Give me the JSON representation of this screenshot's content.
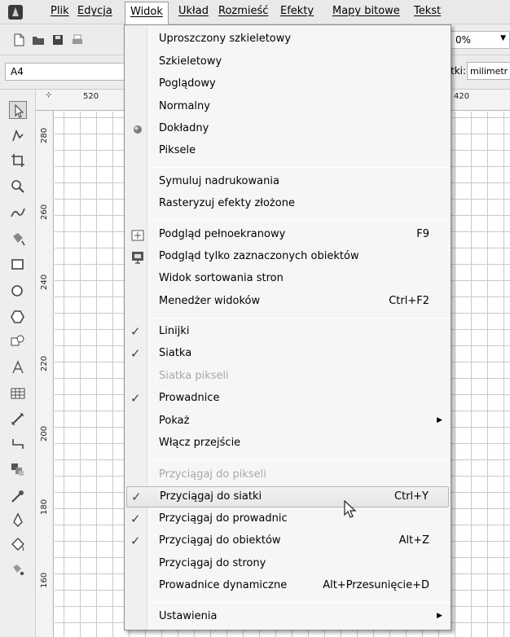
{
  "menubar": {
    "items": [
      {
        "label": "Plik"
      },
      {
        "label": "Edycja"
      },
      {
        "label": "Widok"
      },
      {
        "label": "Układ"
      },
      {
        "label": "Rozmieść"
      },
      {
        "label": "Efekty"
      },
      {
        "label": "Mapy bitowe"
      },
      {
        "label": "Tekst"
      }
    ]
  },
  "toolbar": {
    "zoom_value": "0%"
  },
  "propbar": {
    "page_size": "A4",
    "units_label": "tki:",
    "units_value": "milimetr"
  },
  "rulers": {
    "top_labels": [
      "520",
      "420"
    ],
    "left_labels": [
      "280",
      "260",
      "240",
      "220",
      "200",
      "180",
      "160"
    ]
  },
  "view_menu": {
    "items": [
      {
        "label": "Uproszczony szkieletowy"
      },
      {
        "label": "Szkieletowy"
      },
      {
        "label": "Poglądowy"
      },
      {
        "label": "Normalny"
      },
      {
        "label": "Dokładny"
      },
      {
        "label": "Piksele"
      },
      {
        "label": "Symuluj nadrukowania"
      },
      {
        "label": "Rasteryzuj efekty złożone"
      },
      {
        "label": "Podgląd pełnoekranowy",
        "shortcut": "F9"
      },
      {
        "label": "Podgląd tylko zaznaczonych obiektów"
      },
      {
        "label": "Widok sortowania stron"
      },
      {
        "label": "Menedżer widoków",
        "shortcut": "Ctrl+F2"
      },
      {
        "label": "Linijki"
      },
      {
        "label": "Siatka"
      },
      {
        "label": "Siatka pikseli"
      },
      {
        "label": "Prowadnice"
      },
      {
        "label": "Pokaż"
      },
      {
        "label": "Włącz przejście"
      },
      {
        "label": "Przyciągaj do pikseli"
      },
      {
        "label": "Przyciągaj do siatki",
        "shortcut": "Ctrl+Y"
      },
      {
        "label": "Przyciągaj do prowadnic"
      },
      {
        "label": "Przyciągaj do obiektów",
        "shortcut": "Alt+Z"
      },
      {
        "label": "Przyciągaj do strony"
      },
      {
        "label": "Prowadnice dynamiczne",
        "shortcut": "Alt+Przesunięcie+D"
      },
      {
        "label": "Ustawienia"
      }
    ],
    "checked": [
      "Linijki",
      "Siatka",
      "Prowadnice",
      "Przyciągaj do siatki",
      "Przyciągaj do prowadnic",
      "Przyciągaj do obiektów"
    ],
    "disabled": [
      "Siatka pikseli",
      "Przyciągaj do pikseli"
    ],
    "highlighted": "Przyciągaj do siatki",
    "submenus": [
      "Pokaż",
      "Ustawienia"
    ]
  },
  "icons": {
    "check": "✓",
    "submenu_arrow": "▶",
    "dropdown_arrow": "▼"
  }
}
